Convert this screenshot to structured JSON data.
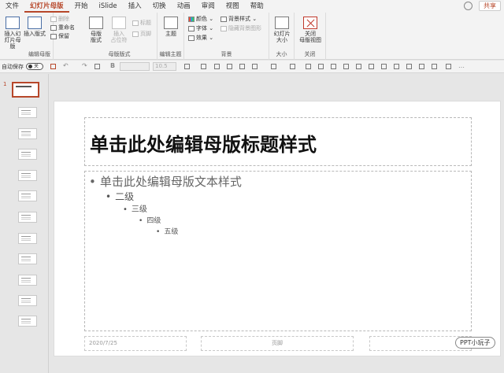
{
  "ribbon_tabs": [
    "文件",
    "幻灯片母版",
    "开始",
    "iSlide",
    "插入",
    "切换",
    "动画",
    "审阅",
    "视图",
    "帮助"
  ],
  "share_label": "共享",
  "groups": {
    "edit_master": {
      "label": "编辑母版",
      "insert_slide_master": "插入幻\n灯片母版",
      "insert_layout": "插入版式",
      "delete": "删除",
      "rename": "重命名",
      "preserve": "保留"
    },
    "master_layout": {
      "label": "母版版式",
      "master_layout_btn": "母版\n版式",
      "insert_placeholder": "插入\n占位符",
      "title": "标题",
      "footer": "页脚"
    },
    "edit_theme": {
      "label": "编辑主题",
      "theme": "主题"
    },
    "background": {
      "label": "背景",
      "colors": "颜色",
      "fonts": "字体",
      "effects": "效果",
      "bg_styles": "背景样式",
      "hide_bg": "隐藏背景图形"
    },
    "size": {
      "label": "大小",
      "slide_size": "幻灯片\n大小"
    },
    "close": {
      "label": "关闭",
      "close_master": "关闭\n母版视图"
    }
  },
  "qat": {
    "autosave": "自动保存",
    "toggle": "关",
    "bold": "B",
    "font_size": "10.5"
  },
  "slide_number": "1",
  "slide": {
    "title": "单击此处编辑母版标题样式",
    "levels": [
      "单击此处编辑母版文本样式",
      "二级",
      "三级",
      "四级",
      "五级"
    ],
    "footer_date": "2020/7/25",
    "footer_text": "页脚"
  },
  "watermark": "PPT小玩子",
  "accent_color": "#b7472a"
}
